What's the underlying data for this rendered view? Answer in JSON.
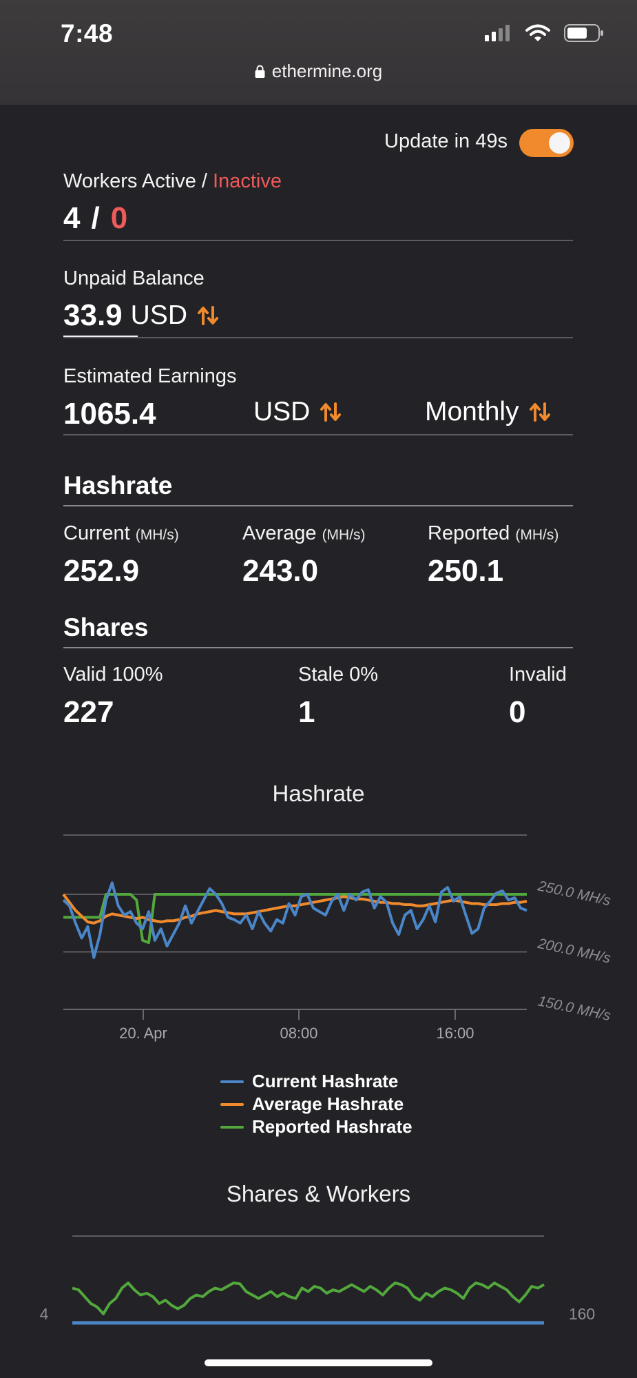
{
  "status_bar": {
    "time": "7:48"
  },
  "browser": {
    "url": "ethermine.org"
  },
  "update": {
    "label": "Update in 49s",
    "enabled": true
  },
  "workers": {
    "label_prefix": "Workers Active / ",
    "label_inactive": "Inactive",
    "active": "4",
    "separator": "/",
    "inactive": "0"
  },
  "unpaid": {
    "label": "Unpaid Balance",
    "value": "33.9",
    "currency": "USD"
  },
  "earnings": {
    "label": "Estimated Earnings",
    "value": "1065.4",
    "currency": "USD",
    "period": "Monthly"
  },
  "hashrate": {
    "title": "Hashrate",
    "current": {
      "label": "Current",
      "unit": "(MH/s)",
      "value": "252.9"
    },
    "average": {
      "label": "Average",
      "unit": "(MH/s)",
      "value": "243.0"
    },
    "reported": {
      "label": "Reported",
      "unit": "(MH/s)",
      "value": "250.1"
    }
  },
  "shares": {
    "title": "Shares",
    "valid": {
      "label": "Valid 100%",
      "value": "227"
    },
    "stale": {
      "label": "Stale 0%",
      "value": "1"
    },
    "invalid": {
      "label": "Invalid",
      "value": "0"
    }
  },
  "colors": {
    "accent": "#f08a2c",
    "inactive": "#ef5a5a",
    "current": "#4a86c8",
    "average": "#f08a2c",
    "reported": "#52a83c"
  },
  "chart_data": [
    {
      "type": "line",
      "title": "Hashrate",
      "x_ticks": [
        "20. Apr",
        "08:00",
        "16:00"
      ],
      "y_ticks": [
        "250.0 MH/s",
        "200.0 MH/s",
        "150.0 MH/s"
      ],
      "ylim": [
        150,
        250
      ],
      "y_axis_side": "right",
      "grid": true,
      "legend": "bottom",
      "series": [
        {
          "name": "Current Hashrate",
          "color": "#4a86c8",
          "values": [
            245,
            240,
            225,
            212,
            222,
            195,
            215,
            245,
            260,
            240,
            232,
            235,
            225,
            220,
            235,
            210,
            220,
            205,
            215,
            225,
            240,
            225,
            235,
            245,
            255,
            250,
            242,
            230,
            228,
            225,
            232,
            220,
            235,
            225,
            218,
            228,
            225,
            242,
            232,
            248,
            250,
            238,
            235,
            232,
            244,
            250,
            236,
            250,
            245,
            252,
            254,
            238,
            248,
            243,
            225,
            215,
            232,
            236,
            220,
            228,
            240,
            226,
            252,
            256,
            244,
            248,
            232,
            216,
            220,
            238,
            244,
            251,
            253,
            245,
            247,
            238,
            236
          ]
        },
        {
          "name": "Average Hashrate",
          "color": "#f08a2c",
          "values": [
            250,
            243,
            236,
            231,
            226,
            225,
            227,
            231,
            233,
            232,
            231,
            230,
            229,
            230,
            228,
            227,
            226,
            227,
            227,
            228,
            230,
            231,
            233,
            234,
            235,
            236,
            235,
            234,
            233,
            233,
            233,
            234,
            235,
            236,
            237,
            238,
            239,
            240,
            240,
            241,
            242,
            243,
            244,
            245,
            246,
            247,
            248,
            247,
            246,
            246,
            245,
            244,
            243,
            243,
            242,
            242,
            241,
            241,
            240,
            240,
            241,
            242,
            243,
            244,
            245,
            244,
            243,
            242,
            242,
            241,
            241,
            241,
            242,
            242,
            243,
            243,
            244
          ]
        },
        {
          "name": "Reported Hashrate",
          "color": "#52a83c",
          "values": [
            230,
            230,
            230,
            230,
            230,
            230,
            230,
            250,
            250,
            250,
            250,
            250,
            245,
            210,
            208,
            250,
            250,
            250,
            250,
            250,
            250,
            250,
            250,
            250,
            250,
            250,
            250,
            250,
            250,
            250,
            250,
            250,
            250,
            250,
            250,
            250,
            250,
            250,
            250,
            250,
            250,
            250,
            250,
            250,
            250,
            250,
            250,
            250,
            250,
            250,
            250,
            250,
            250,
            250,
            250,
            250,
            250,
            250,
            250,
            250,
            250,
            250,
            250,
            250,
            250,
            250,
            250,
            250,
            250,
            250,
            250,
            250,
            250,
            250,
            250,
            250,
            250
          ]
        }
      ]
    },
    {
      "type": "line",
      "title": "Shares & Workers",
      "y_left_ticks": [
        "4"
      ],
      "y_right_ticks": [
        "160"
      ],
      "grid": true,
      "series": [
        {
          "color": "#52a83c",
          "axis": "right",
          "values": [
            150,
            148,
            140,
            132,
            128,
            120,
            132,
            138,
            150,
            156,
            148,
            142,
            144,
            140,
            132,
            136,
            130,
            126,
            130,
            138,
            142,
            140,
            146,
            150,
            148,
            152,
            156,
            155,
            146,
            142,
            138,
            142,
            146,
            140,
            144,
            140,
            138,
            150,
            146,
            152,
            150,
            144,
            148,
            146,
            150,
            154,
            150,
            146,
            152,
            148,
            142,
            150,
            156,
            154,
            150,
            140,
            136,
            144,
            140,
            146,
            150,
            148,
            144,
            138,
            150,
            156,
            154,
            150,
            156,
            152,
            148,
            140,
            134,
            142,
            152,
            150,
            154
          ]
        },
        {
          "color": "#4a86c8",
          "axis": "left",
          "values": [
            4,
            4,
            4,
            4,
            4,
            4,
            4,
            4,
            4,
            4,
            4,
            4,
            4,
            4,
            4,
            4,
            4,
            4,
            4,
            4,
            4,
            4,
            4,
            4,
            4,
            4,
            4,
            4,
            4,
            4,
            4,
            4,
            4,
            4,
            4,
            4,
            4,
            4,
            4,
            4,
            4,
            4,
            4,
            4,
            4,
            4,
            4,
            4,
            4,
            4,
            4,
            4,
            4,
            4,
            4,
            4,
            4,
            4,
            4,
            4,
            4,
            4,
            4,
            4,
            4,
            4,
            4,
            4,
            4,
            4,
            4,
            4,
            4,
            4,
            4,
            4,
            4
          ]
        }
      ]
    }
  ]
}
